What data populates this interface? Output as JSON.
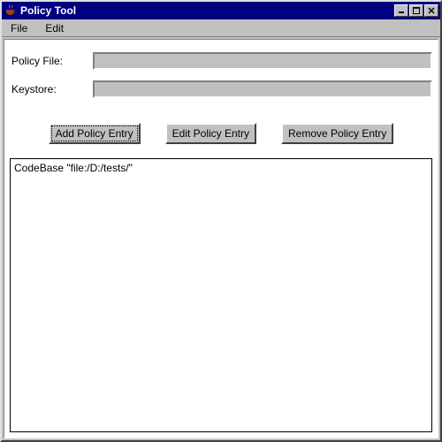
{
  "window": {
    "title": "Policy Tool",
    "controls": {
      "minimize": "_",
      "maximize": "□",
      "close": "X"
    }
  },
  "menubar": {
    "items": [
      {
        "label": "File"
      },
      {
        "label": "Edit"
      }
    ]
  },
  "fields": {
    "policy_file": {
      "label": "Policy File:",
      "value": ""
    },
    "keystore": {
      "label": "Keystore:",
      "value": ""
    }
  },
  "buttons": {
    "add": "Add Policy Entry",
    "edit": "Edit Policy Entry",
    "remove": "Remove Policy Entry"
  },
  "entries": [
    {
      "text": "CodeBase \"file:/D:/tests/\""
    }
  ],
  "icons": {
    "java": "☕"
  }
}
